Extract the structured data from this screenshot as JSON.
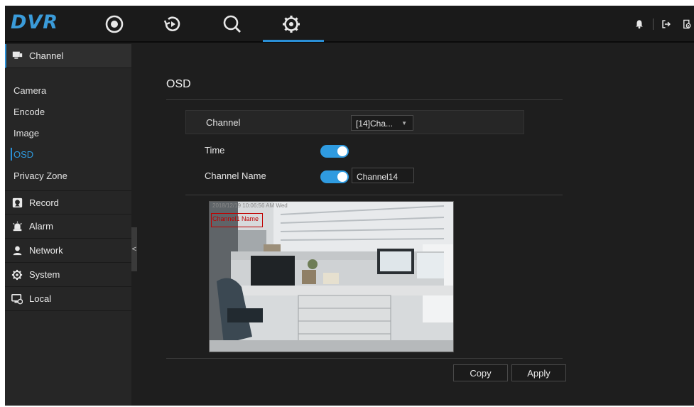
{
  "app": {
    "logo": "DVR"
  },
  "topbar": {
    "nav": [
      {
        "name": "live-view",
        "icon": "record-target-icon"
      },
      {
        "name": "playback",
        "icon": "playback-icon"
      },
      {
        "name": "search",
        "icon": "search-icon"
      },
      {
        "name": "settings",
        "icon": "gear-icon",
        "active": true
      }
    ],
    "right_icons": [
      "bell-icon",
      "logout-icon",
      "lock-icon"
    ],
    "accent": "#2a8fd6"
  },
  "sidebar": {
    "channel": {
      "label": "Channel",
      "icon": "channel-monitor-icon"
    },
    "subitems": [
      {
        "label": "Camera"
      },
      {
        "label": "Encode"
      },
      {
        "label": "Image"
      },
      {
        "label": "OSD",
        "active": true
      },
      {
        "label": "Privacy Zone"
      }
    ],
    "groups": [
      {
        "label": "Record",
        "icon": "record-icon"
      },
      {
        "label": "Alarm",
        "icon": "alarm-icon"
      },
      {
        "label": "Network",
        "icon": "network-user-icon"
      },
      {
        "label": "System",
        "icon": "system-gear-icon"
      },
      {
        "label": "Local",
        "icon": "local-icon"
      }
    ],
    "collapse_glyph": "<"
  },
  "osd": {
    "title": "OSD",
    "channel_label": "Channel",
    "channel_value": "[14]Cha...",
    "time_label": "Time",
    "time_enabled": true,
    "channel_name_label": "Channel Name",
    "channel_name_enabled": true,
    "channel_name_value": "Channel14",
    "preview": {
      "time_overlay": "2018/12/19 10:06:56 AM Wed",
      "name_overlay": "Channel1 Name"
    },
    "buttons": {
      "copy": "Copy",
      "apply": "Apply"
    }
  }
}
